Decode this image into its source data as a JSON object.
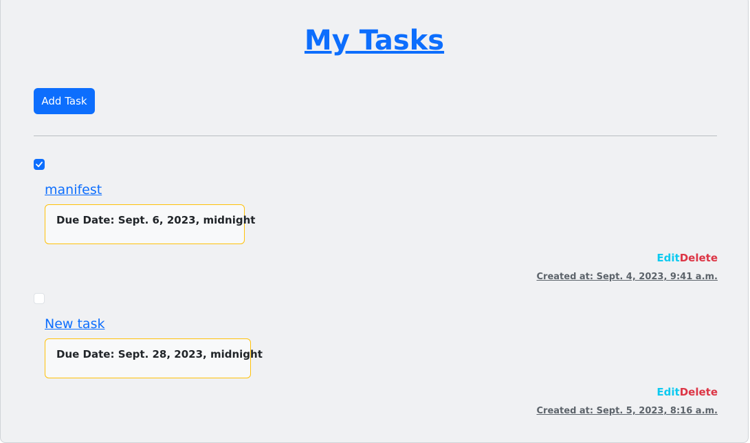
{
  "page": {
    "title": "My Tasks",
    "add_task_label": "Add Task"
  },
  "tasks": [
    {
      "title": "manifest",
      "completed": true,
      "due_label": "Due Date:",
      "due_value": "Sept. 6, 2023, midnight",
      "edit_label": "Edit",
      "delete_label": "Delete",
      "created_label": "Created at: Sept. 4, 2023, 9:41 a.m."
    },
    {
      "title": "New task",
      "completed": false,
      "due_label": "Due Date:",
      "due_value": "Sept. 28, 2023, midnight",
      "edit_label": "Edit",
      "delete_label": "Delete",
      "created_label": "Created at: Sept. 5, 2023, 8:16 a.m."
    }
  ],
  "colors": {
    "primary": "#0d6efd",
    "info": "#0dcaf0",
    "danger": "#dc3545",
    "warning_border": "#ffc107",
    "panel_bg": "#f0f1f3"
  }
}
